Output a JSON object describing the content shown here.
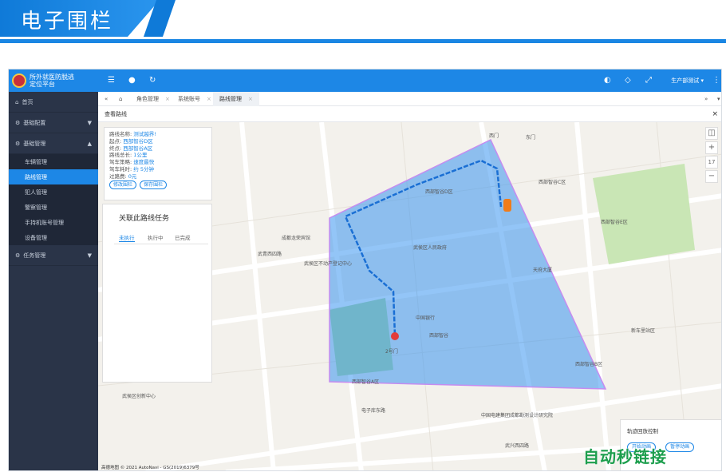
{
  "banner": {
    "title": "电子围栏"
  },
  "app": {
    "logo": {
      "line1": "所外就医防脱逃",
      "line2": "定位平台"
    },
    "sidebar": [
      {
        "label": "首页",
        "icon": "home-icon"
      },
      {
        "label": "基础配置",
        "icon": "gear-icon",
        "arrow": "▼"
      },
      {
        "label": "基础管理",
        "icon": "gear-icon",
        "arrow": "▲"
      }
    ],
    "submenu": [
      "车辆管理",
      "路线管理",
      "犯人管理",
      "警察管理",
      "手持机账号管理",
      "设备管理"
    ],
    "task_menu": {
      "label": "任务管理",
      "arrow": "▼"
    },
    "topbar": {
      "user": "生产部测试 ▾"
    },
    "tabs": [
      "角色管理",
      "系统账号",
      "路线管理"
    ],
    "subhead": "查看路线",
    "info": {
      "name_label": "路线名称:",
      "name": "测试越界!",
      "start_label": "起点:",
      "start": "西部智谷D区",
      "end_label": "终点:",
      "end": "西部智谷A区",
      "length_label": "路线总长:",
      "length": "1公里",
      "strategy_label": "驾车策略:",
      "strategy": "速度最快",
      "time_label": "驾车耗时:",
      "time": "约 5分钟",
      "toll_label": "过路费:",
      "toll": "0元",
      "btn_edit": "修改围栏",
      "btn_save": "保存围栏"
    },
    "task": {
      "title": "关联此路线任务",
      "tabs": [
        "未执行",
        "执行中",
        "已完成"
      ]
    },
    "zoom": {
      "level": "17"
    },
    "control": {
      "title": "轨迹回放控制",
      "start": "开始动画",
      "stop": "暂停动画"
    },
    "copyright": "高德地图 © 2021 AutoNavi - GS(2019)6379号",
    "map_labels": [
      "西部智谷D区",
      "武青西四路",
      "西部智谷",
      "武侯区人民政府",
      "中国银行",
      "电子库东路",
      "武兴西四路",
      "西门",
      "天府大厦",
      "东门",
      "2号门",
      "西部智谷A区",
      "武侯区不动产登记中心",
      "成都龙荣宾馆",
      "中国电建集团成都勘测设计研究院",
      "武侯区创新中心",
      "西部智谷C区",
      "新车里站区",
      "西部智谷E区",
      "西部智谷B区"
    ]
  },
  "watermark": "自动秒链接"
}
